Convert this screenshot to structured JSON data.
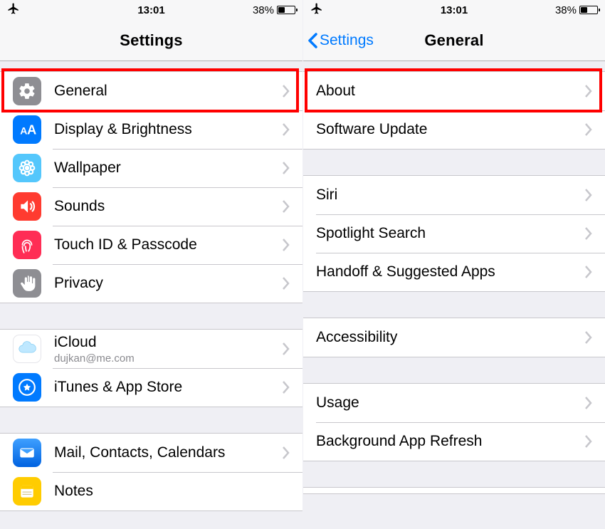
{
  "statusbar": {
    "time": "13:01",
    "battery_pct": "38%"
  },
  "left": {
    "title": "Settings",
    "rows1": [
      {
        "id": "general",
        "label": "General"
      },
      {
        "id": "display",
        "label": "Display & Brightness"
      },
      {
        "id": "wallpaper",
        "label": "Wallpaper"
      },
      {
        "id": "sounds",
        "label": "Sounds"
      },
      {
        "id": "touchid",
        "label": "Touch ID & Passcode"
      },
      {
        "id": "privacy",
        "label": "Privacy"
      }
    ],
    "rows2": [
      {
        "id": "icloud",
        "label": "iCloud",
        "sub": "dujkan@me.com"
      },
      {
        "id": "itunes",
        "label": "iTunes & App Store"
      }
    ],
    "rows3": [
      {
        "id": "mail",
        "label": "Mail, Contacts, Calendars"
      },
      {
        "id": "notes",
        "label": "Notes"
      }
    ]
  },
  "right": {
    "back": "Settings",
    "title": "General",
    "g1": [
      {
        "id": "about",
        "label": "About"
      },
      {
        "id": "sw",
        "label": "Software Update"
      }
    ],
    "g2": [
      {
        "id": "siri",
        "label": "Siri"
      },
      {
        "id": "spotlight",
        "label": "Spotlight Search"
      },
      {
        "id": "handoff",
        "label": "Handoff & Suggested Apps"
      }
    ],
    "g3": [
      {
        "id": "access",
        "label": "Accessibility"
      }
    ],
    "g4": [
      {
        "id": "usage",
        "label": "Usage"
      },
      {
        "id": "bgref",
        "label": "Background App Refresh"
      }
    ]
  }
}
